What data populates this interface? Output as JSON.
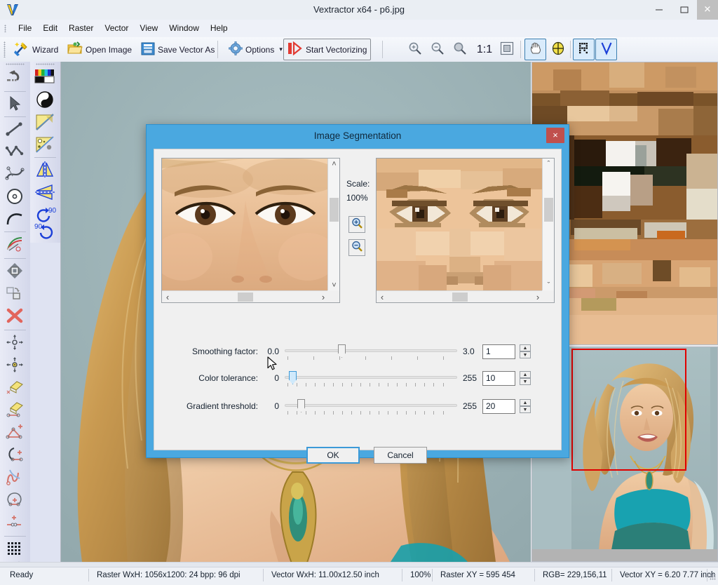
{
  "window": {
    "title": "Vextractor x64 - p6.jpg",
    "app_icon": "vextractor-logo-icon",
    "minimize_label": "–",
    "maximize_label": "❐",
    "close_label": "×"
  },
  "menubar": {
    "items": [
      {
        "label": "File"
      },
      {
        "label": "Edit"
      },
      {
        "label": "Raster"
      },
      {
        "label": "Vector"
      },
      {
        "label": "View"
      },
      {
        "label": "Window"
      },
      {
        "label": "Help"
      }
    ]
  },
  "toolbar": {
    "wizard_label": "Wizard",
    "open_image_label": "Open Image",
    "save_vector_label": "Save Vector As",
    "options_label": "Options",
    "options_dropdown_caret": "▾",
    "start_vectorizing_label": "Start Vectorizing",
    "zoom_ratio_label": "1:1",
    "icons": {
      "wizard": "magic-wand-icon",
      "open_image": "open-folder-icon",
      "save_vector": "floppy-disk-icon",
      "options": "gear-icon",
      "start_vectorizing": "play-vectorize-icon",
      "zoom_in": "zoom-in-icon",
      "zoom_out": "zoom-out-icon",
      "zoom_area": "zoom-area-icon",
      "fit_window": "fit-to-window-icon",
      "pan": "hand-pan-icon",
      "target": "crosshair-target-icon",
      "raster_layer": "raster-layer-icon",
      "vector_layer": "vector-layer-icon"
    }
  },
  "left_palette": {
    "column_one": [
      {
        "name": "undo-tool",
        "icon": "undo-arrow-icon"
      },
      {
        "name": "select-tool",
        "icon": "arrow-pointer-icon"
      },
      {
        "name": "line-tool",
        "icon": "line-segment-icon"
      },
      {
        "name": "polyline-tool",
        "icon": "polyline-icon"
      },
      {
        "name": "bezier-tool",
        "icon": "bezier-curve-icon"
      },
      {
        "name": "circle-tool",
        "icon": "circle-center-icon"
      },
      {
        "name": "arc-tool",
        "icon": "arc-icon"
      },
      {
        "name": "layers-tool",
        "icon": "layers-stack-icon"
      },
      {
        "name": "move-tool",
        "icon": "move-diamond-icon"
      },
      {
        "name": "duplicate-tool",
        "icon": "duplicate-shape-icon"
      },
      {
        "name": "delete-tool",
        "icon": "red-x-icon"
      },
      {
        "name": "node-move-tool",
        "icon": "node-move-icon"
      },
      {
        "name": "node-edit-tool",
        "icon": "node-edit-yellow-icon"
      },
      {
        "name": "erase-point-tool",
        "icon": "eraser-point-icon"
      },
      {
        "name": "erase-line-tool",
        "icon": "eraser-line-icon"
      },
      {
        "name": "add-node-tool",
        "icon": "add-node-icon"
      },
      {
        "name": "arc-node-tool",
        "icon": "arc-node-icon"
      },
      {
        "name": "cut-tool",
        "icon": "scissors-icon"
      },
      {
        "name": "close-contour-tool",
        "icon": "close-contour-icon"
      },
      {
        "name": "join-nodes-tool",
        "icon": "join-nodes-icon"
      },
      {
        "name": "grid-tool",
        "icon": "dot-grid-icon"
      },
      {
        "name": "pick-point-tool",
        "icon": "pick-point-icon"
      }
    ],
    "column_two": [
      {
        "name": "palette-tool",
        "icon": "color-palette-icon"
      },
      {
        "name": "invert-tool",
        "icon": "yin-yang-invert-icon"
      },
      {
        "name": "magic-wand-tool",
        "icon": "magic-wand-yellow-icon"
      },
      {
        "name": "despeckle-tool",
        "icon": "despeckle-icon"
      },
      {
        "name": "flip-vertical-tool",
        "icon": "flip-vertical-icon"
      },
      {
        "name": "flip-horizontal-tool",
        "icon": "flip-horizontal-icon"
      },
      {
        "name": "rotate-cw-tool",
        "icon": "rotate-cw-90-icon",
        "label": "90"
      },
      {
        "name": "rotate-ccw-tool",
        "icon": "rotate-ccw-90-icon",
        "label": "90"
      }
    ]
  },
  "dialog": {
    "title": "Image Segmentation",
    "close_label": "×",
    "scale_label": "Scale:",
    "scale_value": "100%",
    "zoom_in_icon": "zoom-in-icon",
    "zoom_out_icon": "zoom-out-icon",
    "preview_left_name": "original-preview",
    "preview_right_name": "segmented-preview",
    "sliders": [
      {
        "name": "smoothing-factor",
        "label": "Smoothing factor:",
        "min_label": "0.0",
        "max_label": "3.0",
        "value": "1",
        "fraction": 0.33,
        "ticks": 7,
        "highlight": false
      },
      {
        "name": "color-tolerance",
        "label": "Color tolerance:",
        "min_label": "0",
        "max_label": "255",
        "value": "10",
        "fraction": 0.04,
        "ticks": 18,
        "highlight": true
      },
      {
        "name": "gradient-threshold",
        "label": "Gradient threshold:",
        "min_label": "0",
        "max_label": "255",
        "value": "20",
        "fraction": 0.085,
        "ticks": 18,
        "highlight": false
      }
    ],
    "spinner_up": "▲",
    "spinner_dn": "▼",
    "ok_label": "OK",
    "cancel_label": "Cancel",
    "scroll_left_arrow": "‹",
    "scroll_right_arrow": "›",
    "scroll_up_arrow": "˄",
    "scroll_down_arrow": "˅"
  },
  "panels": {
    "magnifier_name": "pixel-magnifier-panel",
    "navigator_name": "image-navigator-panel"
  },
  "statusbar": {
    "ready_text": "Ready",
    "raster_wxh": "Raster WxH: 1056x1200: 24 bpp: 96 dpi",
    "vector_wxh": "Vector WxH: 11.00x12.50 inch",
    "zoom_percent": "100%",
    "raster_xy": "Raster XY =  595  454",
    "rgb": "RGB= 229,156,11",
    "vector_xy": "Vector XY =  6.20  7.77 inch"
  },
  "colors": {
    "dialog_accent": "#4aa8e0",
    "close_red": "#c0504d",
    "nav_rect": "#e00000",
    "canvas_bg": "#9fb4b8",
    "skin": "#e7b68c",
    "teal_dress": "#1b9aa8"
  }
}
